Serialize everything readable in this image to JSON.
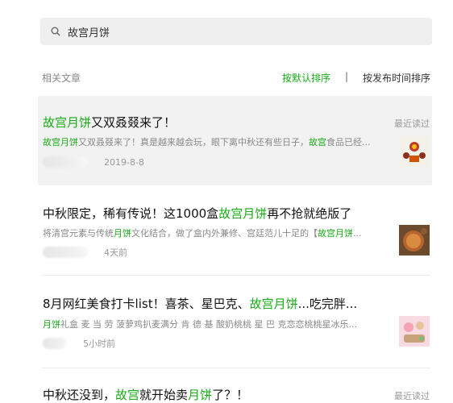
{
  "search": {
    "query": "故宫月饼"
  },
  "filter": {
    "label": "相关文章",
    "sort_default": "按默认排序",
    "separator": "|",
    "sort_time": "按发布时间排序"
  },
  "results": [
    {
      "title_hl": "故宫月饼",
      "title_rest": "又双叒叕来了！",
      "desc_hl1": "故宫月饼",
      "desc_mid": "又双叒叕来了！真是越来越会玩，眼下离中秋还有些日子，",
      "desc_hl2": "故宫",
      "desc_tail": "食品已经...",
      "date": "2019-8-8",
      "recent": "最近读过"
    },
    {
      "title_pre": "中秋限定，稀有传说！这1000盒",
      "title_hl": "故宫月饼",
      "title_post": "再不抢就绝版了",
      "desc_pre": "将清宫元素与传统",
      "desc_hl1": "月饼",
      "desc_mid": "文化结合，做了盒内外兼修、宫廷范儿十足的【",
      "desc_hl2": "故宫月饼",
      "desc_tail": "...",
      "date": "4天前"
    },
    {
      "title_pre": "8月网红美食打卡list！喜茶、星巴克、",
      "title_hl": "故宫月饼",
      "title_post": "...吃完胖...",
      "desc_hl1": "月饼",
      "desc_mid": "礼盒 麦 当 劳 菠萝鸡扒麦满分 肯 德 基 酸奶桃桃 星 巴 克恋恋桃桃星冰乐...",
      "date": "5小时前"
    },
    {
      "title_pre": "中秋还没到，",
      "title_hl": "故宫",
      "title_mid": "就开始卖",
      "title_hl2": "月饼",
      "title_post": "了？！",
      "recent": "最近读过"
    }
  ],
  "colors": {
    "accent": "#1aad19",
    "muted": "#999999",
    "highlight_bg": "#f2f2f2"
  }
}
